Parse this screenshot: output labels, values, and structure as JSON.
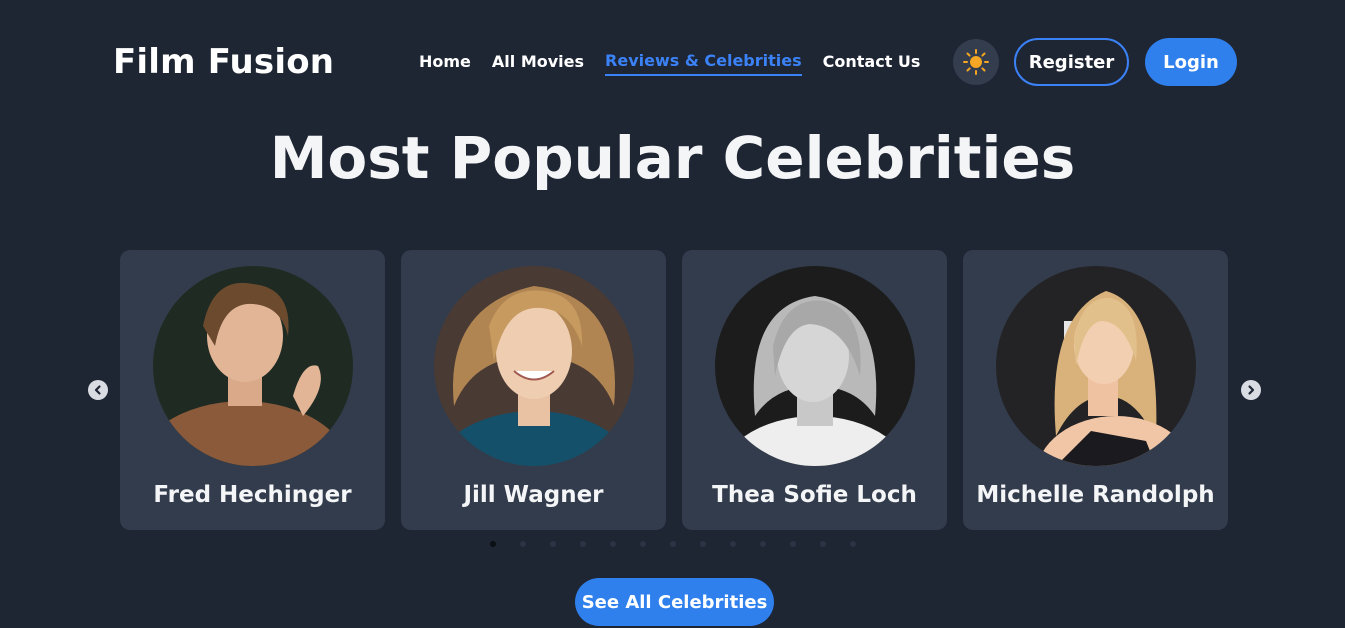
{
  "header": {
    "brand": "Film Fusion",
    "nav": [
      {
        "label": "Home",
        "active": false
      },
      {
        "label": "All Movies",
        "active": false
      },
      {
        "label": "Reviews & Celebrities",
        "active": true
      },
      {
        "label": "Contact Us",
        "active": false
      }
    ],
    "theme_icon": "sun-icon",
    "register_label": "Register",
    "login_label": "Login"
  },
  "section": {
    "title": "Most Popular Celebrities"
  },
  "carousel": {
    "prev_icon": "chevron-left-icon",
    "next_icon": "chevron-right-icon",
    "cards": [
      {
        "name": "Fred Hechinger"
      },
      {
        "name": "Jill Wagner"
      },
      {
        "name": "Thea Sofie Loch"
      },
      {
        "name": "Michelle Randolph"
      }
    ],
    "page_count": 13,
    "active_page": 1
  },
  "cta": {
    "see_all_label": "See All Celebrities"
  },
  "colors": {
    "background": "#1e2533",
    "card": "#323c4c",
    "accent": "#2f80ed",
    "sun": "#f5a623"
  }
}
